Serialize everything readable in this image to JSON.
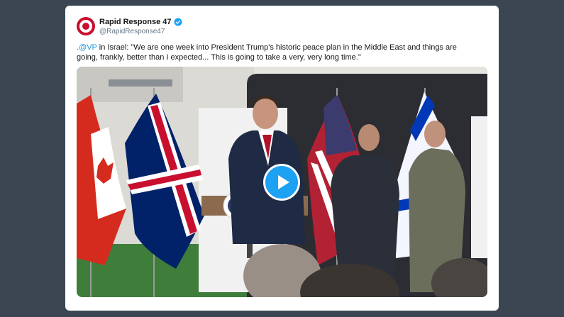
{
  "tweet": {
    "display_name": "Rapid Response 47",
    "handle": "@RapidResponse47",
    "mention": ".@VP",
    "text_after_mention": " in Israel: \"We are one week into President Trump's historic peace plan in the Middle East and things are going, frankly, better than I expected... This is going to take a very, very long time.\""
  },
  "media": {
    "type": "video",
    "play_icon": "play-icon"
  },
  "colors": {
    "background": "#3c4653",
    "accent": "#1da1f2",
    "mention": "#1b95e0",
    "avatar": "#c8102e"
  }
}
